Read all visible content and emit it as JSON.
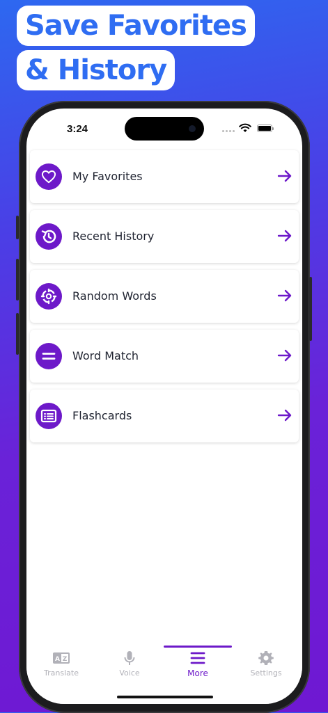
{
  "headline": {
    "line1": "Save Favorites",
    "line2": "& History"
  },
  "status": {
    "time": "3:24"
  },
  "menu": {
    "items": [
      {
        "label": "My Favorites",
        "icon": "heart-icon"
      },
      {
        "label": "Recent History",
        "icon": "history-icon"
      },
      {
        "label": "Random Words",
        "icon": "shuffle-icon"
      },
      {
        "label": "Word Match",
        "icon": "equals-icon"
      },
      {
        "label": "Flashcards",
        "icon": "list-card-icon"
      }
    ]
  },
  "tabbar": {
    "tabs": [
      {
        "label": "Translate",
        "icon": "translate-icon",
        "active": false
      },
      {
        "label": "Voice",
        "icon": "microphone-icon",
        "active": false
      },
      {
        "label": "More",
        "icon": "menu-icon",
        "active": true
      },
      {
        "label": "Settings",
        "icon": "gear-icon",
        "active": false
      }
    ]
  },
  "colors": {
    "accent": "#6d19c9",
    "headline_text": "#2f6df2",
    "inactive_tab": "#b1b1b8"
  }
}
